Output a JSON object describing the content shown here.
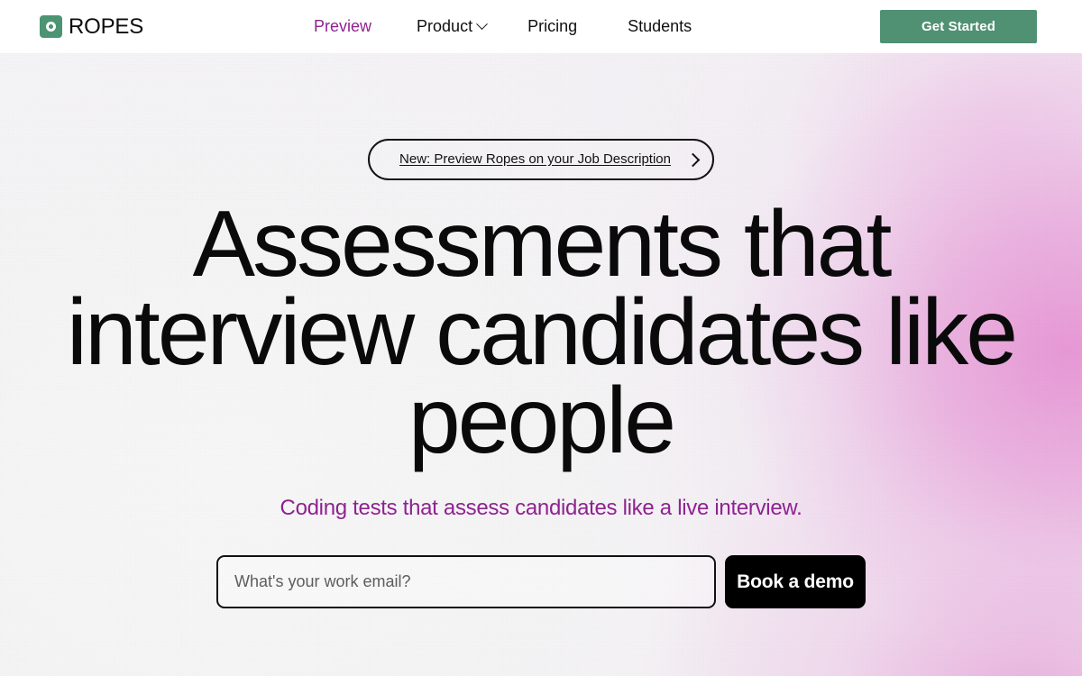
{
  "brand": {
    "name": "ROPES",
    "logo_icon": "ring-in-square-icon",
    "logo_color": "#4c9472"
  },
  "nav": {
    "items": [
      {
        "label": "Preview",
        "active": true,
        "has_dropdown": false
      },
      {
        "label": "Product",
        "active": false,
        "has_dropdown": true
      },
      {
        "label": "Pricing",
        "active": false,
        "has_dropdown": false
      },
      {
        "label": "Students",
        "active": false,
        "has_dropdown": false
      }
    ],
    "cta": {
      "label": "Get Started",
      "color": "#509173"
    },
    "active_color": "#8e2390"
  },
  "hero": {
    "announcement": {
      "text": "New: Preview Ropes on your Job Description",
      "arrow_icon": "chevron-right-icon"
    },
    "headline": "Assessments that interview candidates like people",
    "subhead": "Coding tests that assess candidates like a live interview.",
    "email": {
      "placeholder": "What's your work email?",
      "value": ""
    },
    "demo_button": {
      "label": "Book a demo",
      "color": "#000000"
    },
    "accent_color": "#8e2390",
    "background_gradient": [
      "#f7f7f8",
      "#f0e0f0",
      "#e9bfe4"
    ]
  }
}
